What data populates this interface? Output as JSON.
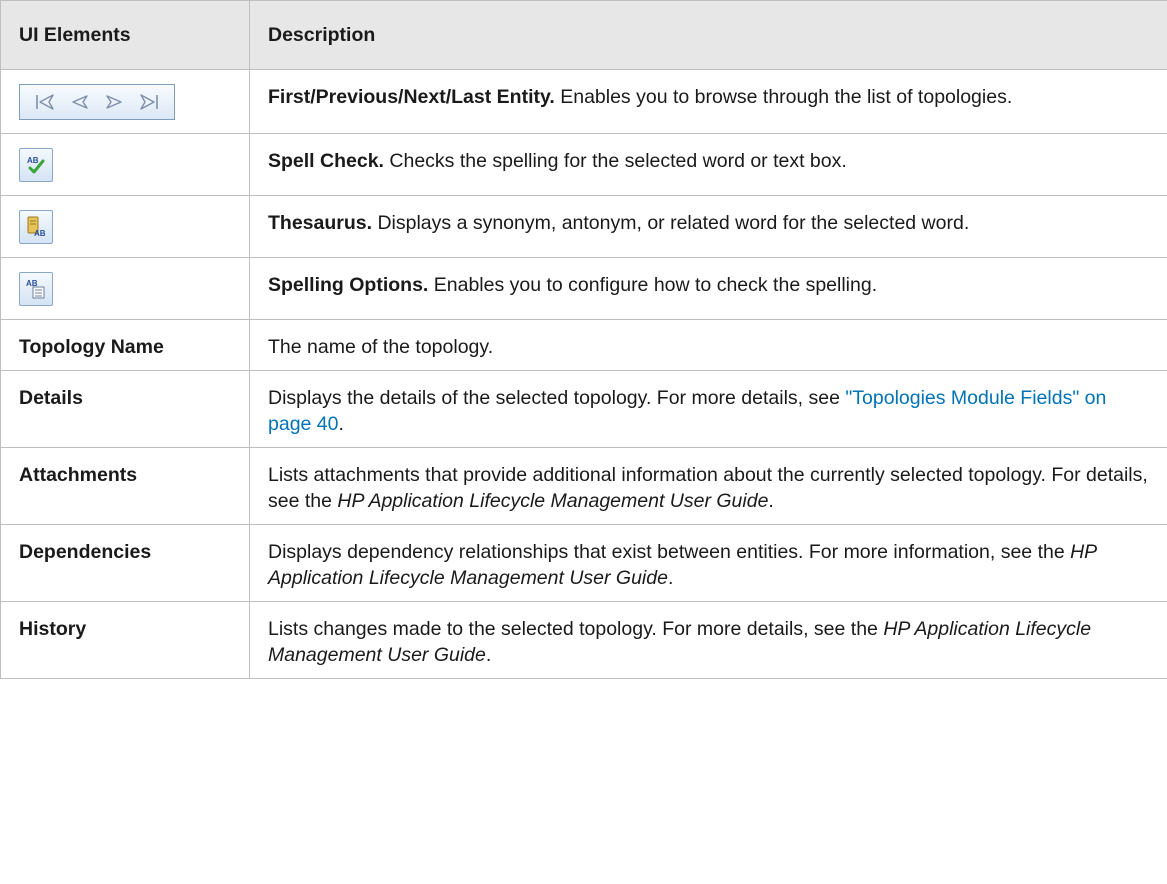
{
  "header": {
    "col1": "UI Elements",
    "col2": "Description"
  },
  "rows": {
    "nav": {
      "icons": [
        "first-entity-icon",
        "previous-entity-icon",
        "next-entity-icon",
        "last-entity-icon"
      ],
      "bold": "First/Previous/Next/Last Entity.",
      "text": " Enables you to browse through the list of topologies."
    },
    "spell": {
      "icon": "spell-check-icon",
      "bold": "Spell Check.",
      "text": " Checks the spelling for the selected word or text box."
    },
    "thesaurus": {
      "icon": "thesaurus-icon",
      "bold": "Thesaurus.",
      "text": " Displays a synonym, antonym, or related word for the selected word."
    },
    "options": {
      "icon": "spelling-options-icon",
      "bold": "Spelling Options.",
      "text": " Enables you to configure how to check the spelling."
    },
    "topology_name": {
      "name": "Topology Name",
      "text": "The name of the topology."
    },
    "details": {
      "name": "Details",
      "text": "Displays the details of the selected topology. For more details, see ",
      "link": "\"Topologies Module Fields\" on page 40",
      "after": "."
    },
    "attachments": {
      "name": "Attachments",
      "text": "Lists attachments that provide additional information about the currently selected topology. For details, see the ",
      "italic": "HP Application Lifecycle Management User Guide",
      "after": "."
    },
    "dependencies": {
      "name": "Dependencies",
      "text": "Displays dependency relationships that exist between entities. For more information, see the ",
      "italic": "HP Application Lifecycle Management User Guide",
      "after": "."
    },
    "history": {
      "name": "History",
      "text": "Lists changes made to the selected topology. For more details, see the ",
      "italic": "HP Application Lifecycle Management User Guide",
      "after": "."
    }
  }
}
